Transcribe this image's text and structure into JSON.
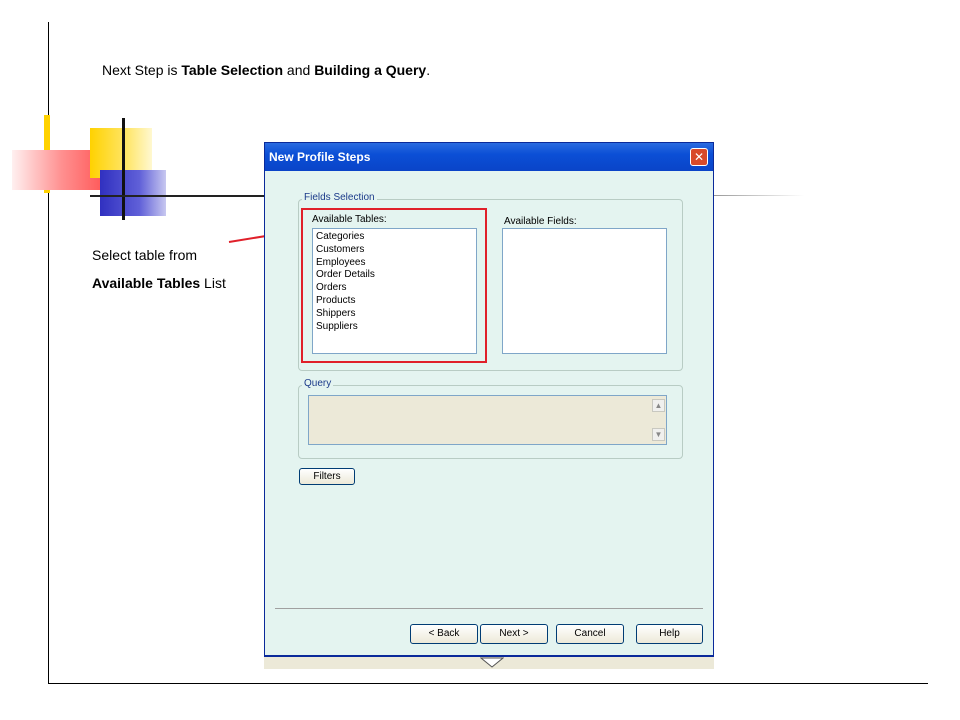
{
  "heading": {
    "prefix": "Next Step is ",
    "bold1": "Table Selection",
    "mid": " and ",
    "bold2": "Building a Query",
    "suffix": "."
  },
  "callout": {
    "line1": "Select table from",
    "bold": "Available Tables",
    "suffix": " List"
  },
  "dialog": {
    "title": "New Profile Steps",
    "close_label": "✕",
    "fields_group_title": "Fields Selection",
    "available_tables_label": "Available Tables:",
    "available_fields_label": "Available Fields:",
    "tables": [
      "Categories",
      "Customers",
      "Employees",
      "Order Details",
      "Orders",
      "Products",
      "Shippers",
      "Suppliers"
    ],
    "query_group_title": "Query",
    "filters_label": "Filters",
    "back_label": "< Back",
    "next_label": "Next >",
    "cancel_label": "Cancel",
    "help_label": "Help"
  },
  "colors": {
    "dialog_bg": "#e4f4f0",
    "titlebar": "#0b4fd6",
    "highlight_box": "#e0202a"
  }
}
